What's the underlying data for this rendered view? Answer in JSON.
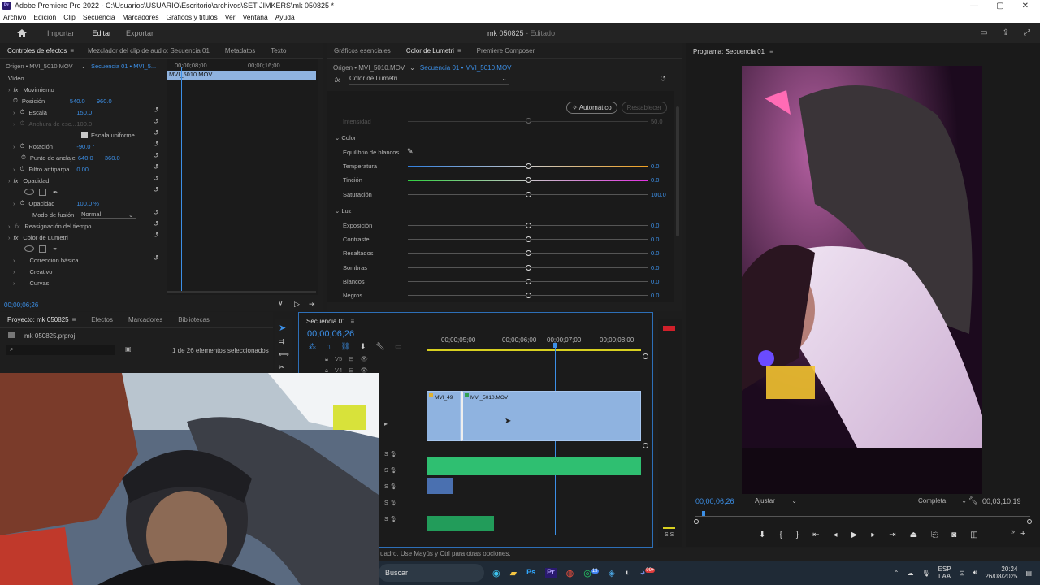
{
  "window": {
    "title": "Adobe Premiere Pro 2022 - C:\\Usuarios\\USUARIO\\Escritorio\\archivos\\SET JIMKERS\\mk 050825 *",
    "minimize": "—",
    "maximize": "▢",
    "close": "✕"
  },
  "menu": [
    "Archivo",
    "Edición",
    "Clip",
    "Secuencia",
    "Marcadores",
    "Gráficos y títulos",
    "Ver",
    "Ventana",
    "Ayuda"
  ],
  "workspace": {
    "tabs": [
      "Importar",
      "Editar",
      "Exportar"
    ],
    "active": "Editar",
    "project": "mk 050825",
    "status": "- Editado"
  },
  "effect_controls": {
    "tabs": [
      "Controles de efectos",
      "Mezclador del clip de audio: Secuencia 01",
      "Metadatos",
      "Texto"
    ],
    "source": "Origen • MVI_5010.MOV",
    "sequence": "Secuencia 01 • MVI_5...",
    "time_00": "00;00;08;00",
    "time_16": "00;00;16;00",
    "clip_name": "MVI_5010.MOV",
    "section_video": "Vídeo",
    "movimiento": "Movimiento",
    "posicion": {
      "label": "Posición",
      "x": "540.0",
      "y": "960.0"
    },
    "escala": {
      "label": "Escala",
      "value": "150.0"
    },
    "anchura": {
      "label": "Anchura de esc...",
      "value": "100.0"
    },
    "escala_uniforme": "Escala uniforme",
    "rotacion": {
      "label": "Rotación",
      "value": "-90.0 °"
    },
    "anclaje": {
      "label": "Punto de anclaje",
      "x": "640.0",
      "y": "360.0"
    },
    "filtro": {
      "label": "Filtro antiparpa...",
      "value": "0.00"
    },
    "opacidad_section": "Opacidad",
    "opacidad": {
      "label": "Opacidad",
      "value": "100.0 %"
    },
    "fusion": {
      "label": "Modo de fusión",
      "value": "Normal"
    },
    "reasignacion": "Reasignación del tiempo",
    "lumetri": "Color de Lumetri",
    "correccion": "Corrección básica",
    "creativo": "Creativo",
    "curvas": "Curvas",
    "timecode": "00;00;06;26"
  },
  "lumetri": {
    "tabs": [
      "Gráficos esenciales",
      "Color de Lumetri",
      "Premiere Composer"
    ],
    "source": "Origen • MVI_5010.MOV",
    "sequence": "Secuencia 01 • MVI_5010.MOV",
    "fx_name": "Color de Lumetri",
    "automatico": "Automático",
    "restablecer": "Restablecer",
    "intensidad": {
      "label": "Intensidad",
      "value": "50.0"
    },
    "color_section": "Color",
    "equilibrio": "Equilibrio de blancos",
    "temperatura": {
      "label": "Temperatura",
      "value": "0.0"
    },
    "tincion": {
      "label": "Tinción",
      "value": "0.0"
    },
    "saturacion": {
      "label": "Saturación",
      "value": "100.0"
    },
    "luz_section": "Luz",
    "exposicion": {
      "label": "Exposición",
      "value": "0.0"
    },
    "contraste": {
      "label": "Contraste",
      "value": "0.0"
    },
    "resaltados": {
      "label": "Resaltados",
      "value": "0.0"
    },
    "sombras": {
      "label": "Sombras",
      "value": "0.0"
    },
    "blancos": {
      "label": "Blancos",
      "value": "0.0"
    },
    "negros": {
      "label": "Negros",
      "value": "0.0"
    }
  },
  "program": {
    "title": "Programa: Secuencia 01",
    "timecode": "00;00;06;26",
    "fit": "Ajustar",
    "quality": "Completa",
    "duration": "00;03;10;19"
  },
  "project": {
    "tabs": [
      "Proyecto: mk 050825",
      "Efectos",
      "Marcadores",
      "Bibliotecas"
    ],
    "file": "mk 050825.prproj",
    "selection": "1 de 26 elementos seleccionados"
  },
  "timeline": {
    "tab": "Secuencia 01",
    "timecode": "00;00;06;26",
    "ruler": [
      "00;00;05;00",
      "00;00;06;00",
      "00;00;07;00",
      "00;00;08;00"
    ],
    "tracks": [
      "V5",
      "V4"
    ],
    "clip1": "MVI_49",
    "clip2": "MVI_5010.MOV",
    "meter_label": "S S"
  },
  "status_bar": "uadro. Use Mayús y Ctrl para otras opciones.",
  "taskbar": {
    "search": "Buscar",
    "lang": "ESP",
    "lang2": "LAA",
    "time": "20:24",
    "date": "26/08/2025",
    "badge1": "13",
    "badge2": "99+"
  }
}
